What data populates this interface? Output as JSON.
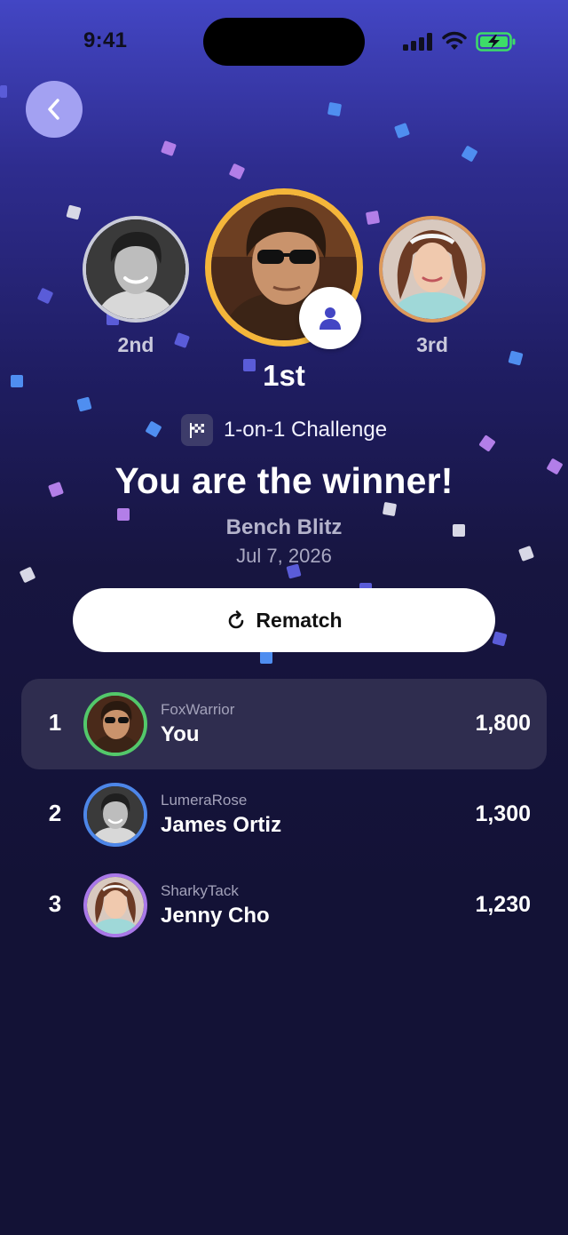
{
  "status_bar": {
    "time": "9:41"
  },
  "colors": {
    "accent": "#4346c4",
    "first_ring": "#f4b63a",
    "second_ring": "#c9cbd8",
    "third_ring": "#dd9a5c",
    "battery": "#3ddc68"
  },
  "podium": {
    "second_label": "2nd",
    "first_label": "1st",
    "third_label": "3rd"
  },
  "challenge": {
    "icon": "checkered-flag-icon",
    "label": "1-on-1 Challenge"
  },
  "headline": "You are the winner!",
  "game": {
    "name": "Bench Blitz",
    "date": "Jul 7, 2026"
  },
  "rematch": {
    "label": "Rematch",
    "icon": "refresh-icon"
  },
  "leaderboard": [
    {
      "rank": "1",
      "handle": "FoxWarrior",
      "name": "You",
      "score": "1,800",
      "ring": "#53c86a"
    },
    {
      "rank": "2",
      "handle": "LumeraRose",
      "name": "James Ortiz",
      "score": "1,300",
      "ring": "#4d86e8"
    },
    {
      "rank": "3",
      "handle": "SharkyTack",
      "name": "Jenny Cho",
      "score": "1,230",
      "ring": "#a978e8"
    }
  ]
}
